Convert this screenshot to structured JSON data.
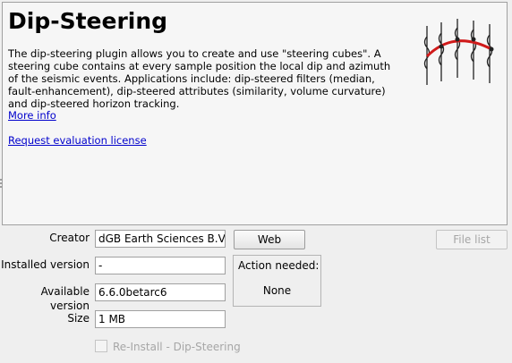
{
  "plugin": {
    "title": "Dip-Steering",
    "description": "The dip-steering plugin allows you to create and use \"steering cubes\". A steering cube contains at every sample position the local dip and azimuth of the seismic events. Applications include: dip-steered filters (median, fault-enhancement), dip-steered attributes (similarity, volume curvature) and dip-steered horizon tracking.",
    "more_info_link": "More info",
    "license_link": "Request evaluation license",
    "logo_icon": "dip-steering-logo-icon"
  },
  "details": {
    "creator_label": "Creator",
    "creator_value": "dGB Earth Sciences B.V.",
    "installed_label": "Installed version",
    "installed_value": "-",
    "available_label": "Available version",
    "available_value": "6.6.0betarc6",
    "size_label": "Size",
    "size_value": "1 MB"
  },
  "buttons": {
    "web": "Web",
    "file_list": "File list"
  },
  "action": {
    "title": "Action needed:",
    "value": "None"
  },
  "reinstall": {
    "label": "Re-Install - Dip-Steering",
    "checked": false,
    "enabled": false
  }
}
